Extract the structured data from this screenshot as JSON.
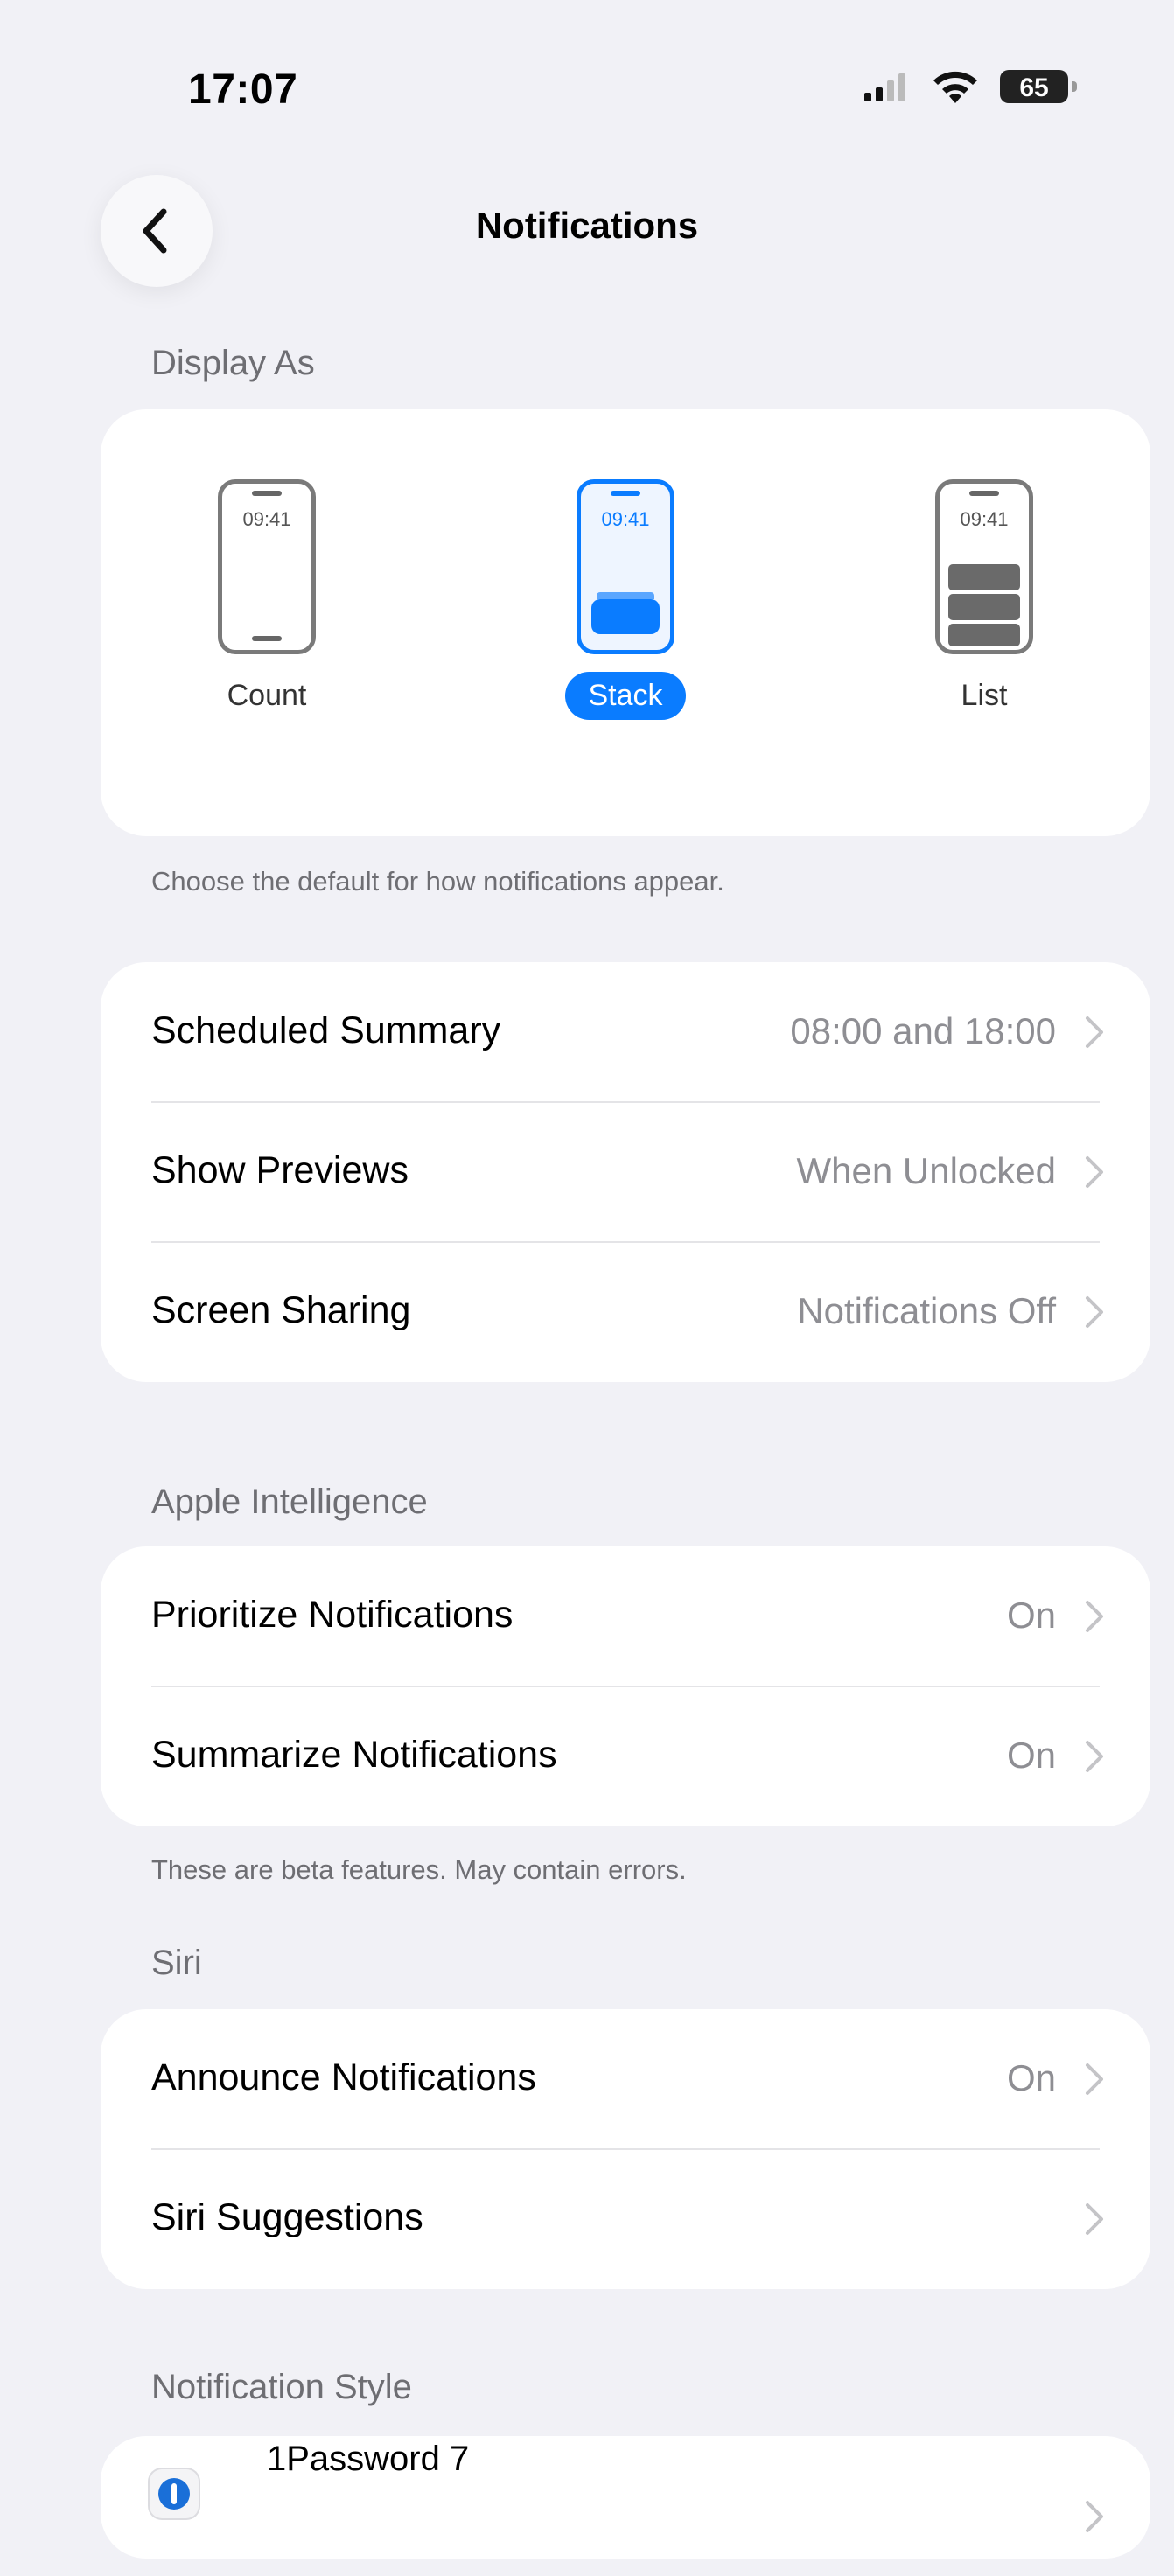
{
  "status_bar": {
    "time": "17:07",
    "battery": "65"
  },
  "nav": {
    "title": "Notifications",
    "back_icon": "chevron-left-icon"
  },
  "display_as": {
    "header": "Display As",
    "options": [
      {
        "clock": "09:41",
        "label": "Count"
      },
      {
        "clock": "09:41",
        "label": "Stack"
      },
      {
        "clock": "09:41",
        "label": "List"
      }
    ],
    "selected": "Stack",
    "footer": "Choose the default for how notifications appear."
  },
  "general": {
    "rows": [
      {
        "label": "Scheduled Summary",
        "value": "08:00 and 18:00"
      },
      {
        "label": "Show Previews",
        "value": "When Unlocked"
      },
      {
        "label": "Screen Sharing",
        "value": "Notifications Off"
      }
    ]
  },
  "apple_intelligence": {
    "header": "Apple Intelligence",
    "rows": [
      {
        "label": "Prioritize Notifications",
        "value": "On"
      },
      {
        "label": "Summarize Notifications",
        "value": "On"
      }
    ],
    "footer": "These are beta features. May contain errors."
  },
  "siri": {
    "header": "Siri",
    "rows": [
      {
        "label": "Announce Notifications",
        "value": "On"
      },
      {
        "label": "Siri Suggestions",
        "value": ""
      }
    ]
  },
  "notification_style": {
    "header": "Notification Style",
    "apps": [
      {
        "name": "1Password 7"
      }
    ]
  },
  "colors": {
    "accent": "#0a7cff",
    "background": "#f1f1f6",
    "secondary_text": "#8e8e93"
  }
}
